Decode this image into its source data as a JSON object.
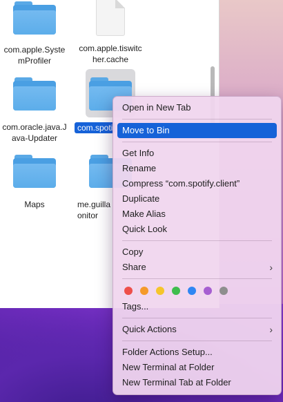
{
  "finder": {
    "items": [
      {
        "label": "com.apple.Syste\nmProfiler",
        "kind": "folder"
      },
      {
        "label": "com.apple.tiswitc\nher.cache",
        "kind": "document"
      },
      {
        "label": "com.oracle.java.J\nava-Updater",
        "kind": "folder"
      },
      {
        "label": "com.spoti",
        "kind": "folder",
        "selected": true
      },
      {
        "label": "Maps",
        "kind": "folder"
      },
      {
        "label": "me.guilla\nonitor",
        "kind": "folder"
      }
    ]
  },
  "context_menu": {
    "open_new_tab": "Open in New Tab",
    "move_to_bin": "Move to Bin",
    "get_info": "Get Info",
    "rename": "Rename",
    "compress": "Compress “com.spotify.client”",
    "duplicate": "Duplicate",
    "make_alias": "Make Alias",
    "quick_look": "Quick Look",
    "copy": "Copy",
    "share": "Share",
    "tag_colors": [
      "#ee4f4a",
      "#f59a2a",
      "#f5c52b",
      "#3fbd4d",
      "#2f86f3",
      "#a65fd1",
      "#8e8e8e"
    ],
    "tags": "Tags...",
    "quick_actions": "Quick Actions",
    "folder_actions_setup": "Folder Actions Setup...",
    "new_terminal_at_folder": "New Terminal at Folder",
    "new_terminal_tab_at_folder": "New Terminal Tab at Folder",
    "submenu_chevron": "›"
  }
}
